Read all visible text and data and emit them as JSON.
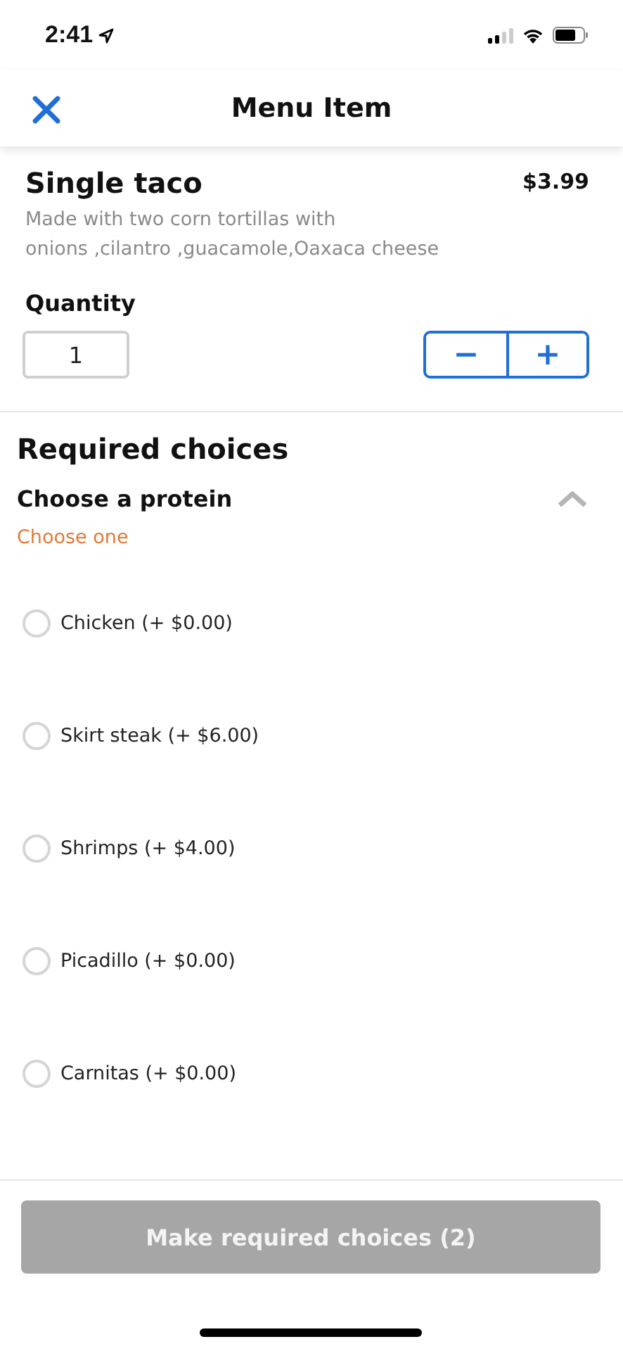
{
  "status_bar": {
    "time": "2:41"
  },
  "nav": {
    "title": "Menu Item"
  },
  "item": {
    "name": "Single taco",
    "price": "$3.99",
    "description": "Made with two corn tortillas with\nonions ,cilantro ,guacamole,Oaxaca cheese"
  },
  "quantity": {
    "label": "Quantity",
    "value": "1",
    "decrement": "−",
    "increment": "+"
  },
  "required": {
    "title": "Required choices",
    "groups": [
      {
        "title": "Choose a protein",
        "hint": "Choose one",
        "expanded": true,
        "options": [
          {
            "label": "Chicken (+ $0.00)",
            "selected": false
          },
          {
            "label": "Skirt steak (+ $6.00)",
            "selected": false
          },
          {
            "label": "Shrimps (+ $4.00)",
            "selected": false
          },
          {
            "label": "Picadillo (+ $0.00)",
            "selected": false
          },
          {
            "label": "Carnitas (+ $0.00)",
            "selected": false
          }
        ]
      }
    ]
  },
  "submit": {
    "label": "Make required choices (2)",
    "disabled": true
  }
}
